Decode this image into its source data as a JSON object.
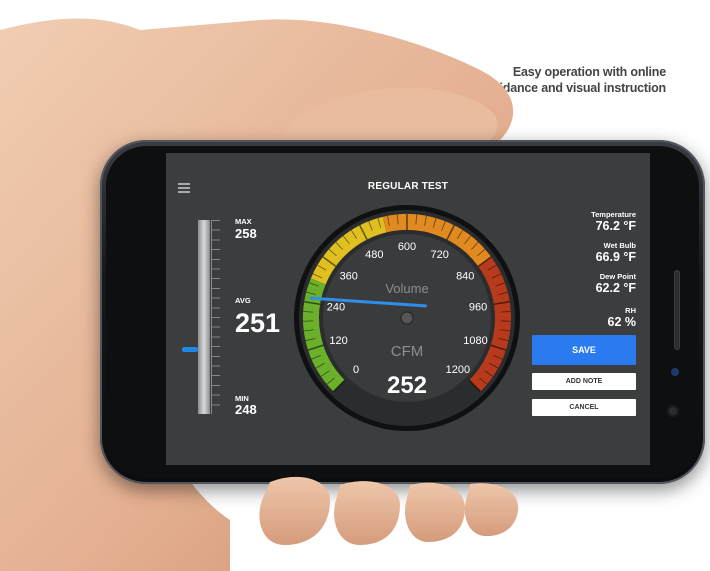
{
  "caption": "Easy operation with online guidance and visual instruction",
  "app": {
    "title": "REGULAR TEST",
    "bar": {
      "max_label": "MAX",
      "max_value": "258",
      "avg_label": "AVG",
      "avg_value": "251",
      "min_label": "MIN",
      "min_value": "248"
    },
    "gauge": {
      "quantity_label": "Volume",
      "unit_label": "CFM",
      "value": "252",
      "scale_labels": [
        "0",
        "120",
        "240",
        "360",
        "480",
        "600",
        "720",
        "840",
        "960",
        "1080",
        "1200"
      ],
      "scale_min": 0,
      "scale_max": 1200,
      "needle_value": 252
    },
    "readouts": [
      {
        "label": "Temperature",
        "value": "76.2 °F"
      },
      {
        "label": "Wet Bulb",
        "value": "66.9 °F"
      },
      {
        "label": "Dew Point",
        "value": "62.2 °F"
      },
      {
        "label": "RH",
        "value": "62 %"
      }
    ],
    "buttons": {
      "save": "SAVE",
      "add_note": "ADD NOTE",
      "cancel": "CANCEL"
    }
  },
  "colors": {
    "screen_bg": "#3c3d3f",
    "accent_blue": "#2a7af0",
    "gauge_green": "#6bb02a",
    "gauge_yellow": "#e0c020",
    "gauge_orange": "#e08a20",
    "gauge_red": "#b83a1c"
  }
}
